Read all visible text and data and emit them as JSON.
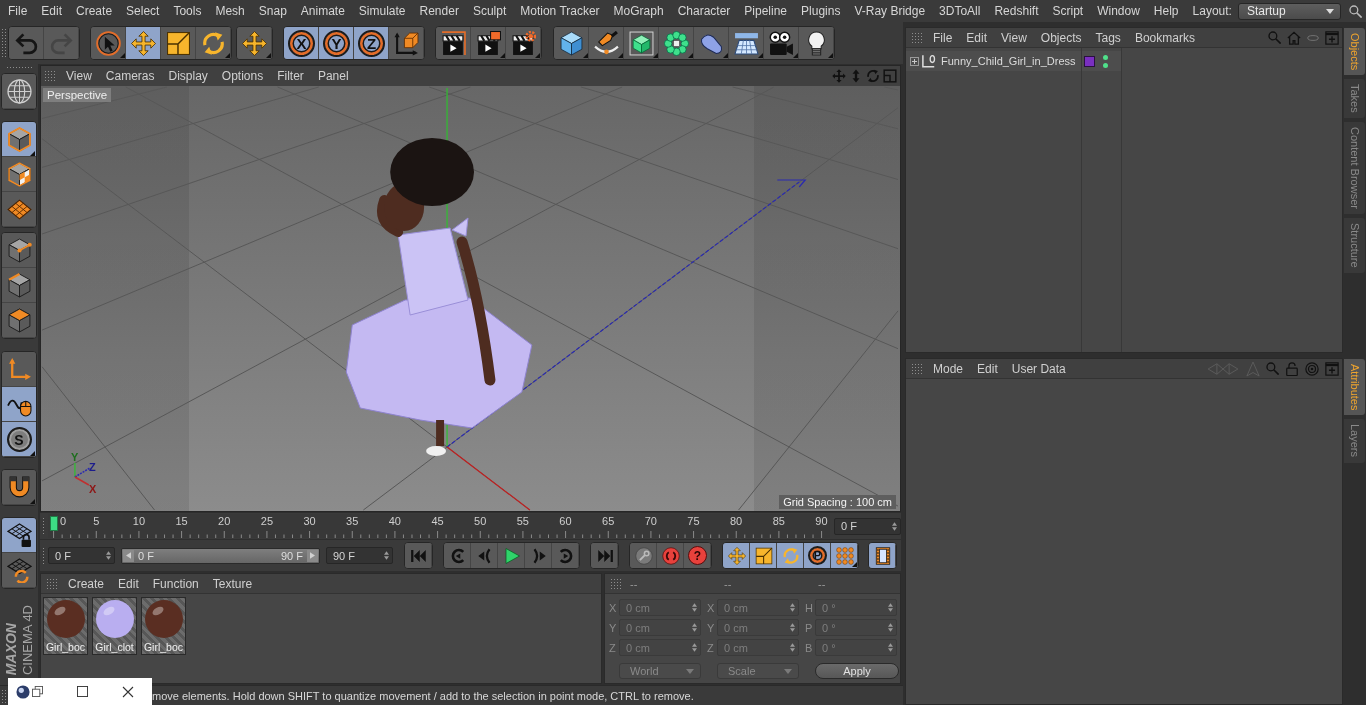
{
  "menu_bar": {
    "items": [
      "File",
      "Edit",
      "Create",
      "Select",
      "Tools",
      "Mesh",
      "Snap",
      "Animate",
      "Simulate",
      "Render",
      "Sculpt",
      "Motion Tracker",
      "MoGraph",
      "Character",
      "Pipeline",
      "Plugins",
      "V-Ray Bridge",
      "3DToAll",
      "Redshift",
      "Script",
      "Window",
      "Help"
    ],
    "layout_label": "Layout:",
    "layout_value": "Startup"
  },
  "toolbar": {
    "groups": [
      {
        "buttons": [
          {
            "selected": false,
            "disabled": false
          },
          {
            "selected": false,
            "disabled": true
          }
        ]
      },
      {
        "buttons": [
          {
            "selected": false,
            "disabled": false
          },
          {
            "selected": true,
            "disabled": false
          },
          {
            "selected": false,
            "disabled": false
          },
          {
            "selected": false,
            "disabled": false
          }
        ]
      },
      {
        "buttons": [
          {
            "selected": false,
            "disabled": false
          }
        ]
      },
      {
        "buttons": [
          {
            "label": "X",
            "selected": true,
            "disabled": false
          },
          {
            "label": "Y",
            "selected": true,
            "disabled": false
          },
          {
            "label": "Z",
            "selected": true,
            "disabled": false
          },
          {
            "selected": false,
            "disabled": false
          }
        ]
      },
      {
        "buttons": [
          {
            "selected": false,
            "disabled": false
          },
          {
            "selected": false,
            "disabled": false
          },
          {
            "selected": false,
            "disabled": false
          }
        ]
      },
      {
        "buttons": [
          {
            "selected": false,
            "disabled": false
          },
          {
            "selected": false,
            "disabled": false
          },
          {
            "selected": false,
            "disabled": false
          },
          {
            "selected": false,
            "disabled": false
          },
          {
            "selected": false,
            "disabled": false
          },
          {
            "selected": false,
            "disabled": false
          },
          {
            "selected": false,
            "disabled": false
          },
          {
            "selected": false,
            "disabled": false
          }
        ]
      }
    ]
  },
  "left_toolbar": {
    "groups": [
      {
        "buttons": [
          {
            "selected": false
          }
        ]
      },
      {
        "buttons": [
          {
            "selected": true
          },
          {
            "selected": false
          },
          {
            "selected": false
          }
        ]
      },
      {
        "buttons": [
          {
            "selected": false
          },
          {
            "selected": false
          },
          {
            "selected": false
          }
        ]
      },
      {
        "buttons": [
          {
            "selected": false
          },
          {
            "selected": true
          },
          {
            "label": "S",
            "selected": true
          }
        ]
      },
      {
        "buttons": [
          {
            "selected": false
          }
        ]
      },
      {
        "buttons": [
          {
            "selected": true
          },
          {
            "selected": false
          }
        ]
      }
    ]
  },
  "logo": {
    "brand": "MAXON",
    "product": "CINEMA 4D"
  },
  "viewport": {
    "menu": [
      "View",
      "Cameras",
      "Display",
      "Options",
      "Filter",
      "Panel"
    ],
    "camera": "Perspective",
    "grid_spacing": "Grid Spacing : 100 cm",
    "axis_labels": [
      "Y",
      "Z",
      "X"
    ]
  },
  "timeline": {
    "ticks": [
      "0",
      "5",
      "10",
      "15",
      "20",
      "25",
      "30",
      "35",
      "40",
      "45",
      "50",
      "55",
      "60",
      "65",
      "70",
      "75",
      "80",
      "85",
      "90"
    ],
    "level": 0,
    "current_frame": "0 F"
  },
  "transport": {
    "start_frame": "0 F",
    "range": {
      "start_label": "0 F",
      "end_label": "90 F",
      "level": 1
    },
    "end_frame": "90 F",
    "groups": [
      {
        "buttons": [
          {
            "selected": false
          }
        ]
      },
      {
        "buttons": [
          {
            "selected": false
          },
          {
            "selected": false
          },
          {
            "selected": false
          },
          {
            "selected": false
          },
          {
            "selected": false
          }
        ]
      },
      {
        "buttons": [
          {
            "selected": false
          }
        ]
      },
      {
        "buttons": [
          {
            "selected": false
          },
          {
            "selected": false
          },
          {
            "label": "?",
            "selected": false
          }
        ]
      },
      {
        "buttons": [
          {
            "selected": true
          },
          {
            "selected": true
          },
          {
            "selected": true
          },
          {
            "label": "P",
            "selected": true
          },
          {
            "selected": true
          }
        ]
      },
      {
        "buttons": [
          {
            "selected": true
          }
        ]
      }
    ]
  },
  "materials": {
    "menu": [
      "Create",
      "Edit",
      "Function",
      "Texture"
    ],
    "items": [
      {
        "name": "Girl_boc",
        "color": "#5a2e22"
      },
      {
        "name": "Girl_clot",
        "color": "#b9aef0"
      },
      {
        "name": "Girl_boc",
        "color": "#5a2e22"
      }
    ]
  },
  "coordinates": {
    "disabled": true,
    "headers": [
      "--",
      "--",
      "--"
    ],
    "rows": [
      {
        "cells": [
          {
            "axis": "X",
            "value": "0 cm"
          },
          {
            "axis": "X",
            "value": "0 cm"
          },
          {
            "axis": "H",
            "value": "0 °"
          }
        ]
      },
      {
        "cells": [
          {
            "axis": "Y",
            "value": "0 cm"
          },
          {
            "axis": "Y",
            "value": "0 cm"
          },
          {
            "axis": "P",
            "value": "0 °"
          }
        ]
      },
      {
        "cells": [
          {
            "axis": "Z",
            "value": "0 cm"
          },
          {
            "axis": "Z",
            "value": "0 cm"
          },
          {
            "axis": "B",
            "value": "0 °"
          }
        ]
      }
    ],
    "dropdowns": [
      "World",
      "Scale"
    ],
    "apply": "Apply"
  },
  "status_bar": {
    "text": "move elements. Hold down SHIFT to quantize movement / add to the selection in point mode, CTRL to remove."
  },
  "object_manager": {
    "menu": [
      "File",
      "Edit",
      "View",
      "Objects",
      "Tags",
      "Bookmarks"
    ],
    "objects": [
      {
        "name": "Funny_Child_Girl_in_Dress",
        "expanded": false,
        "visibility_dots": [
          {
            "color": "#4fe08a"
          },
          {
            "color": "#4fe08a"
          }
        ]
      }
    ]
  },
  "attribute_manager": {
    "menu": [
      "Mode",
      "Edit",
      "User Data"
    ]
  },
  "side_tabs": {
    "upper": [
      {
        "label": "Objects",
        "selected": true
      },
      {
        "label": "Takes",
        "selected": false
      },
      {
        "label": "Content Browser",
        "selected": false
      },
      {
        "label": "Structure",
        "selected": false
      }
    ],
    "lower": [
      {
        "label": "Attributes",
        "selected": true
      },
      {
        "label": "Layers",
        "selected": false
      }
    ]
  }
}
